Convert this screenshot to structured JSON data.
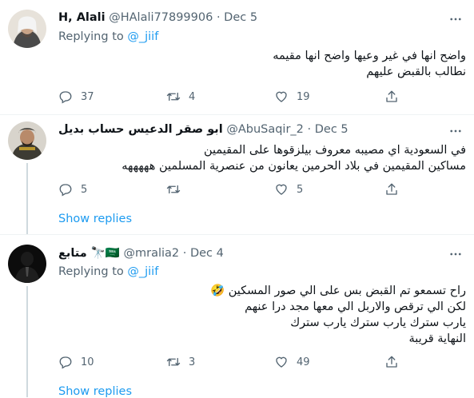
{
  "tweets": [
    {
      "name": "H, Alali",
      "handle": "@HAlali77899906",
      "sep": "·",
      "date": "Dec 5",
      "replying_prefix": "Replying to",
      "replying_to": "@_jiif",
      "lines": [
        "واضح انها في غير وعيها واضح انها مقيمه",
        "نطالب بالقبض عليهم"
      ],
      "replies": "37",
      "retweets": "4",
      "likes": "19"
    },
    {
      "name": "ابو صقر الدعيس حساب بديل",
      "handle": "@AbuSaqir_2",
      "sep": "·",
      "date": "Dec 5",
      "lines": [
        "في السعودية اي مصيبه معروف بيلزقوها على المقيمين",
        "مساكين المقيمين في بلاد الحرمين يعانون من عنصرية المسلمين هههههه"
      ],
      "replies": "5",
      "retweets": "",
      "likes": "5",
      "show_replies": "Show replies"
    },
    {
      "name": "متابع 🔭🇸🇦",
      "handle": "@mralia2",
      "sep": "·",
      "date": "Dec 4",
      "replying_prefix": "Replying to",
      "replying_to": "@_jiif",
      "lines": [
        "راح تسمعو تم القبض بس على الي صور المسكين 🤣",
        "لكن الي ترقص والاربل الي معها مجد درا عنهم",
        "يارب سترك يارب سترك يارب سترك",
        "النهاية قريبة"
      ],
      "replies": "10",
      "retweets": "3",
      "likes": "49",
      "show_replies": "Show replies"
    }
  ],
  "icons": {
    "reply": "reply-icon",
    "retweet": "retweet-icon",
    "like": "heart-icon",
    "share": "share-icon",
    "more": "more-icon"
  },
  "colors": {
    "link": "#1d9bf0",
    "secondary": "#536471",
    "divider": "#eff3f4"
  }
}
